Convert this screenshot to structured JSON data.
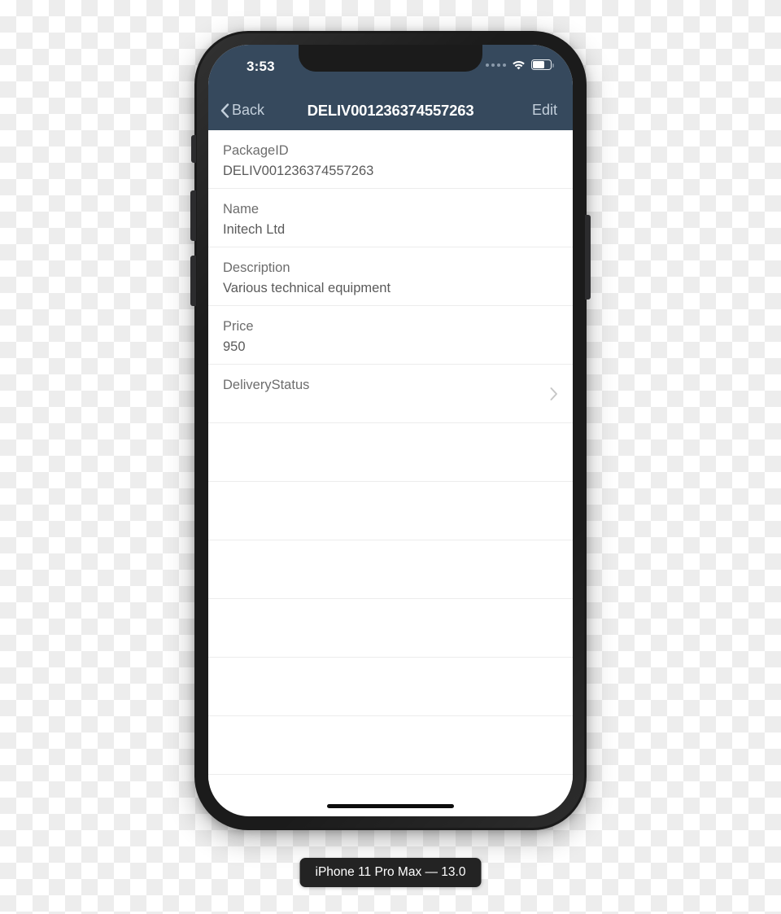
{
  "device": {
    "caption": "iPhone 11 Pro Max — 13.0",
    "frame_color": "#1b1b1b"
  },
  "status_bar": {
    "time": "3:53",
    "signal_icon": "signal-dots-icon",
    "wifi_icon": "wifi-icon",
    "battery_icon": "battery-icon",
    "battery_level": "58%",
    "background_color": "#36495d"
  },
  "nav_bar": {
    "back_label": "Back",
    "back_icon": "chevron-left-icon",
    "title": "DELIV001236374557263",
    "edit_label": "Edit",
    "background_color": "#36495d",
    "tint_color": "#c3cfdb"
  },
  "detail_list": {
    "rows": [
      {
        "label": "PackageID",
        "value": "DELIV001236374557263",
        "chevron": false
      },
      {
        "label": "Name",
        "value": "Initech Ltd",
        "chevron": false
      },
      {
        "label": "Description",
        "value": "Various technical equipment",
        "chevron": false
      },
      {
        "label": "Price",
        "value": "950",
        "chevron": false
      },
      {
        "label": "DeliveryStatus",
        "value": "",
        "chevron": true
      }
    ],
    "empty_row_count": 6,
    "separator_color": "#ececec"
  }
}
